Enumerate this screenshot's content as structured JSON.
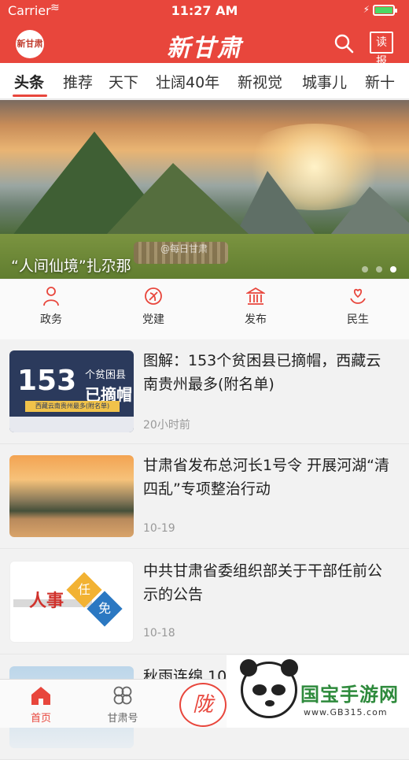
{
  "status_bar": {
    "carrier": "Carrier",
    "time": "11:27 AM"
  },
  "header": {
    "logo_text": "新甘肃",
    "brand": "新甘肃",
    "read_label": "读报"
  },
  "tabs": [
    "头条",
    "推荐",
    "天下",
    "壮阔40年",
    "新视觉",
    "城事儿",
    "新十"
  ],
  "banner": {
    "caption": "“人间仙境”扎尕那",
    "watermark": "@每日甘肃",
    "slide_count": 3,
    "active_slide": 3
  },
  "quick_links": [
    "政务",
    "党建",
    "发布",
    "民生"
  ],
  "feed": [
    {
      "title": "图解：153个贫困县已摘帽，西藏云南贵州最多(附名单)",
      "time": "20小时前",
      "thumb": {
        "big": "153",
        "cap1": "个贫困县",
        "cap2": "已摘帽",
        "band": "西藏云南贵州最多(附名单)"
      }
    },
    {
      "title": "甘肃省发布总河长1号令 开展河湖“清四乱”专项整治行动",
      "time": "10-19"
    },
    {
      "title": "中共甘肃省委组织部关于干部任前公示的公告",
      "time": "10-18",
      "thumb": {
        "w1": "人事",
        "w2": "任",
        "w3": "免"
      }
    },
    {
      "title": "秋雨连绵 10",
      "time": ""
    }
  ],
  "tabbar": {
    "home": "首页",
    "gansu": "甘肃号",
    "center_logo": "陇"
  },
  "ad": {
    "title": "国宝手游网",
    "url": "www.GB315.com"
  },
  "colors": {
    "accent": "#e8463c",
    "text": "#222222",
    "muted": "#999999"
  }
}
